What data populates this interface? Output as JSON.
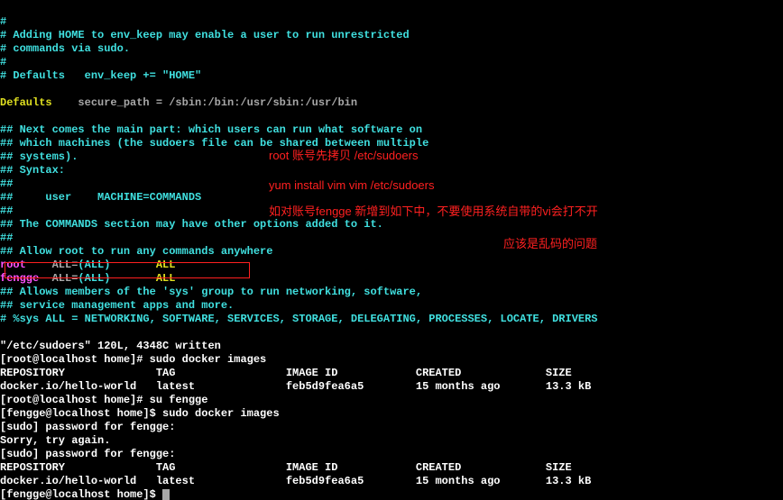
{
  "sudoers_lines": [
    {
      "cls": "cyan",
      "text": "#"
    },
    {
      "cls": "cyan",
      "text": "# Adding HOME to env_keep may enable a user to run unrestricted"
    },
    {
      "cls": "cyan",
      "text": "# commands via sudo."
    },
    {
      "cls": "cyan",
      "text": "#"
    },
    {
      "cls": "cyan",
      "text": "# Defaults   env_keep += \"HOME\""
    },
    {
      "cls": "cyan",
      "text": ""
    },
    {
      "cls": "mixed",
      "segments": [
        {
          "cls": "yellow",
          "text": "Defaults"
        },
        {
          "cls": "gray",
          "text": "    secure_path = /sbin:/bin:/usr/sbin:/usr/bin"
        }
      ]
    },
    {
      "cls": "cyan",
      "text": ""
    },
    {
      "cls": "cyan",
      "text": "## Next comes the main part: which users can run what software on"
    },
    {
      "cls": "cyan",
      "text": "## which machines (the sudoers file can be shared between multiple"
    },
    {
      "cls": "cyan",
      "text": "## systems)."
    },
    {
      "cls": "cyan",
      "text": "## Syntax:"
    },
    {
      "cls": "cyan",
      "text": "##"
    },
    {
      "cls": "cyan",
      "text": "##     user    MACHINE=COMMANDS"
    },
    {
      "cls": "cyan",
      "text": "##"
    },
    {
      "cls": "cyan",
      "text": "## The COMMANDS section may have other options added to it."
    },
    {
      "cls": "cyan",
      "text": "##"
    },
    {
      "cls": "cyan",
      "text": "## Allow root to run any commands anywhere"
    },
    {
      "cls": "mixed",
      "segments": [
        {
          "cls": "magenta",
          "text": "root    "
        },
        {
          "cls": "gray",
          "text": "ALL="
        },
        {
          "cls": "cyan",
          "text": "(ALL)"
        },
        {
          "cls": "gray",
          "text": "       "
        },
        {
          "cls": "yellow",
          "text": "ALL"
        }
      ]
    },
    {
      "cls": "mixed",
      "segments": [
        {
          "cls": "magenta",
          "text": "fengge  "
        },
        {
          "cls": "gray",
          "text": "ALL="
        },
        {
          "cls": "cyan",
          "text": "(ALL)"
        },
        {
          "cls": "gray",
          "text": "       "
        },
        {
          "cls": "yellow",
          "text": "ALL"
        }
      ]
    },
    {
      "cls": "cyan",
      "text": "## Allows members of the 'sys' group to run networking, software,"
    },
    {
      "cls": "cyan",
      "text": "## service management apps and more."
    },
    {
      "cls": "cyan",
      "text": "# %sys ALL = NETWORKING, SOFTWARE, SERVICES, STORAGE, DELEGATING, PROCESSES, LOCATE, DRIVERS"
    }
  ],
  "shell_lines": [
    {
      "segments": [
        {
          "cls": "white",
          "text": "\"/etc/sudoers\" 120L, 4348C written"
        }
      ]
    },
    {
      "segments": [
        {
          "cls": "white",
          "text": "[root@localhost home]# sudo docker images"
        }
      ]
    },
    {
      "segments": [
        {
          "cls": "white",
          "text": "REPOSITORY              TAG                 IMAGE ID            CREATED             SIZE"
        }
      ]
    },
    {
      "segments": [
        {
          "cls": "white",
          "text": "docker.io/hello-world   latest              feb5d9fea6a5        15 months ago       13.3 kB"
        }
      ]
    },
    {
      "segments": [
        {
          "cls": "white",
          "text": "[root@localhost home]# su fengge"
        }
      ]
    },
    {
      "segments": [
        {
          "cls": "white",
          "text": "[fengge@localhost home]$ sudo docker images"
        }
      ]
    },
    {
      "segments": [
        {
          "cls": "white",
          "text": "[sudo] password for fengge:"
        }
      ]
    },
    {
      "segments": [
        {
          "cls": "white",
          "text": "Sorry, try again."
        }
      ]
    },
    {
      "segments": [
        {
          "cls": "white",
          "text": "[sudo] password for fengge:"
        }
      ]
    },
    {
      "segments": [
        {
          "cls": "white",
          "text": "REPOSITORY              TAG                 IMAGE ID            CREATED             SIZE"
        }
      ]
    },
    {
      "segments": [
        {
          "cls": "white",
          "text": "docker.io/hello-world   latest              feb5d9fea6a5        15 months ago       13.3 kB"
        }
      ]
    },
    {
      "segments": [
        {
          "cls": "white",
          "text": "[fengge@localhost home]$ "
        }
      ],
      "cursor": true
    }
  ],
  "annotations": {
    "a1": "root 账号先拷贝 /etc/sudoers",
    "a2": "yum install vim  vim /etc/sudoers",
    "a3": "如对账号fengge 新增到如下中，不要使用系统自带的vi会打不开",
    "a4": "应该是乱码的问题"
  }
}
